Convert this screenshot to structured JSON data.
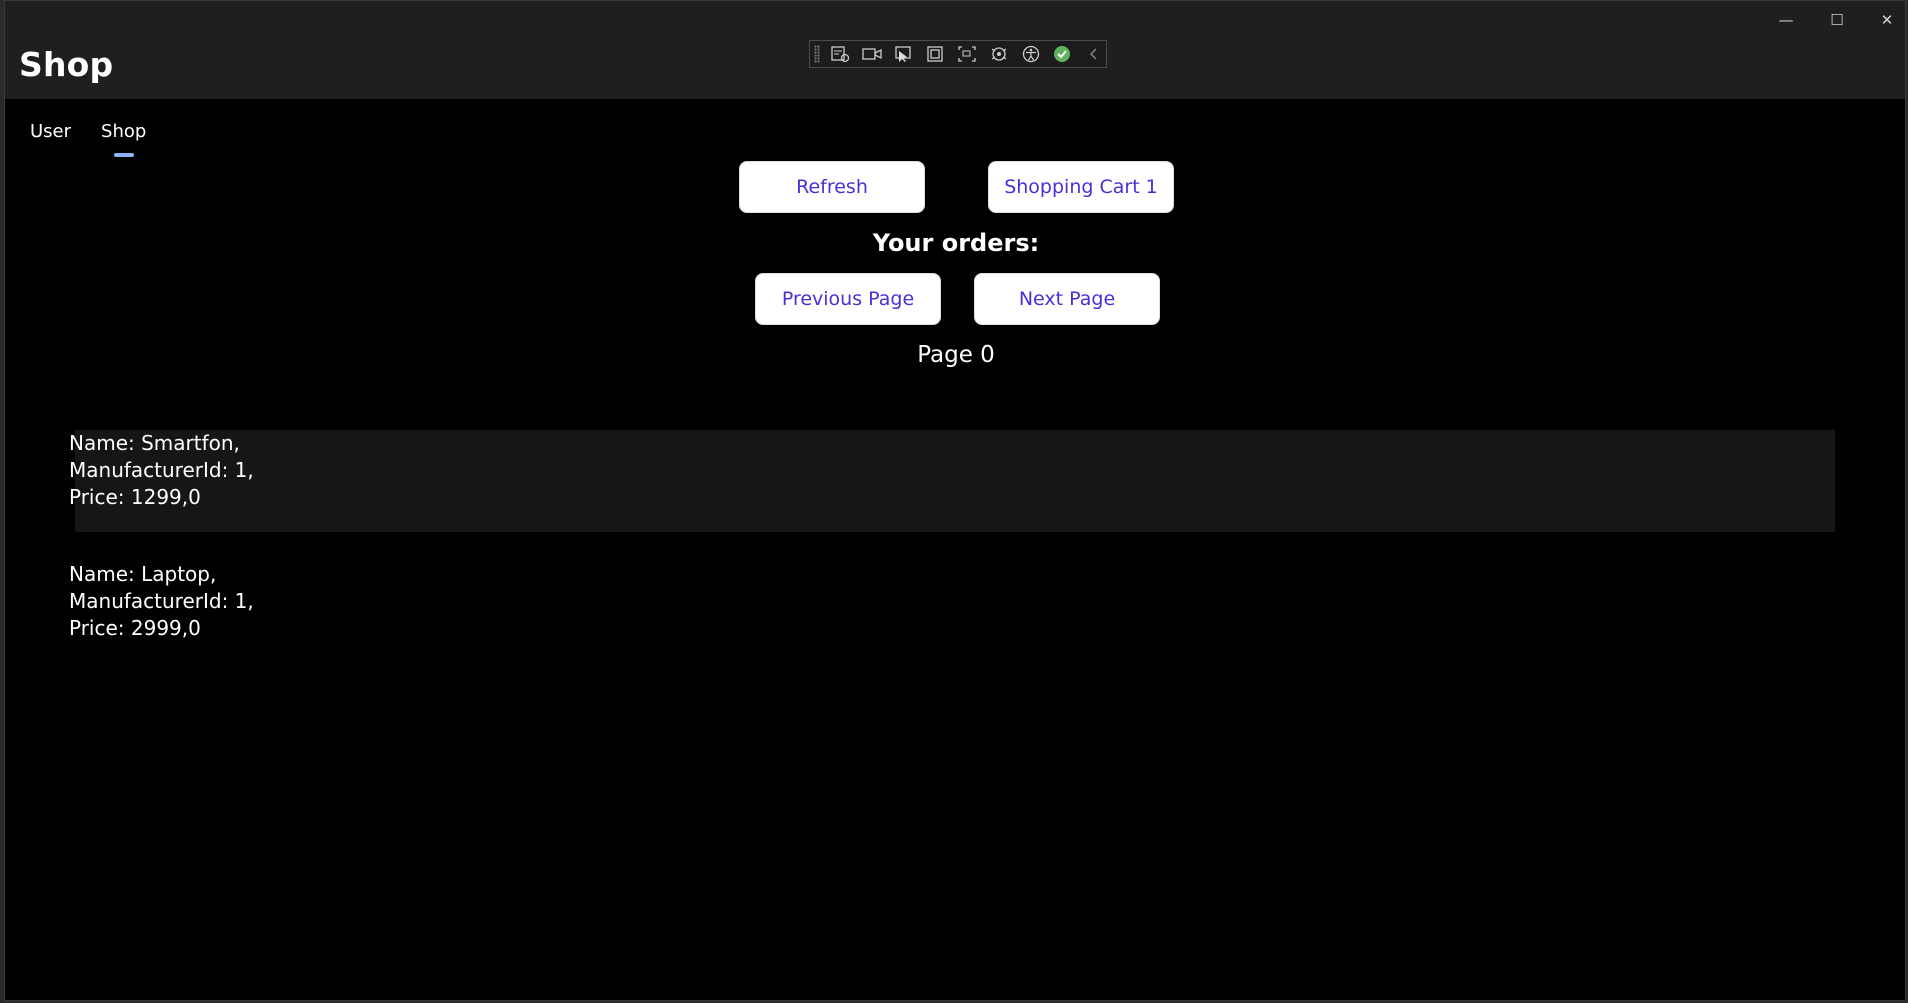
{
  "window": {
    "controls": {
      "minimize": "—",
      "maximize": "☐",
      "close": "✕"
    }
  },
  "app": {
    "title": "Shop"
  },
  "toolbar": {
    "icons": [
      "live-visual-tree-icon",
      "record-icon",
      "select-element-icon",
      "display-layout-adorners-icon",
      "track-focus-icon",
      "binding-failures-icon",
      "accessibility-icon",
      "checkmark-icon",
      "collapse-icon"
    ]
  },
  "tabs": [
    {
      "label": "User",
      "selected": false
    },
    {
      "label": "Shop",
      "selected": true
    }
  ],
  "buttons": {
    "refresh": "Refresh",
    "cart": "Shopping Cart 1",
    "previous": "Previous Page",
    "next": "Next Page"
  },
  "orders_heading": "Your orders:",
  "page_label": "Page 0",
  "products": [
    {
      "name": "Name: Smartfon,",
      "manufacturer": "ManufacturerId: 1,",
      "price": "Price: 1299,0",
      "selected": true
    },
    {
      "name": "Name: Laptop,",
      "manufacturer": "ManufacturerId: 1,",
      "price": "Price: 2999,0",
      "selected": false
    }
  ],
  "colors": {
    "accent": "#8ab4f8",
    "button_text": "#4b2fd6",
    "background": "#000000",
    "header": "#1f1f1f"
  }
}
